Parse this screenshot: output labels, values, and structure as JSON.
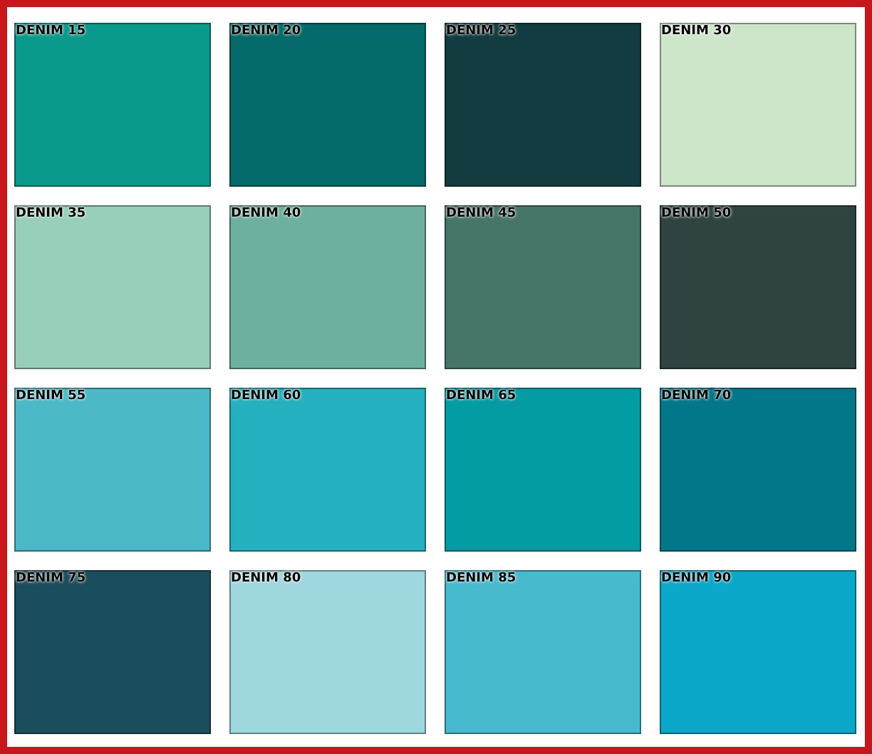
{
  "swatches": [
    {
      "label": "DENIM 15",
      "color": "#0a9a8c"
    },
    {
      "label": "DENIM 20",
      "color": "#046a69"
    },
    {
      "label": "DENIM 25",
      "color": "#123c40"
    },
    {
      "label": "DENIM 30",
      "color": "#cde6c9"
    },
    {
      "label": "DENIM 35",
      "color": "#97cfb9"
    },
    {
      "label": "DENIM 40",
      "color": "#6db09f"
    },
    {
      "label": "DENIM 45",
      "color": "#46756a"
    },
    {
      "label": "DENIM 50",
      "color": "#2f4441"
    },
    {
      "label": "DENIM 55",
      "color": "#4bbac6"
    },
    {
      "label": "DENIM 60",
      "color": "#24b0bf"
    },
    {
      "label": "DENIM 65",
      "color": "#049ca3"
    },
    {
      "label": "DENIM 70",
      "color": "#03778a"
    },
    {
      "label": "DENIM 75",
      "color": "#1b4e5c"
    },
    {
      "label": "DENIM 80",
      "color": "#9fd7de"
    },
    {
      "label": "DENIM 85",
      "color": "#47bbcd"
    },
    {
      "label": "DENIM 90",
      "color": "#0ba7c9"
    }
  ]
}
